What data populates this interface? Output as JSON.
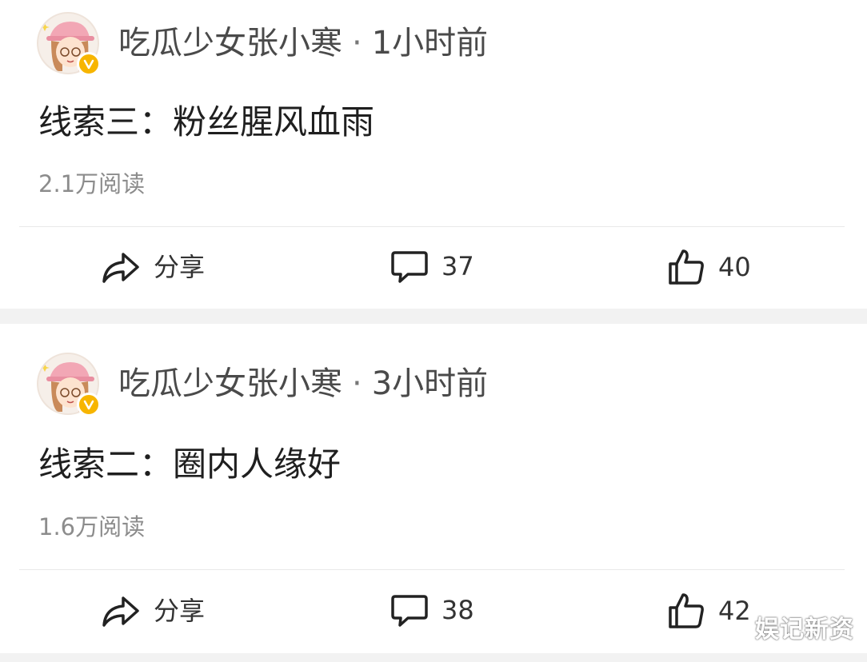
{
  "posts": [
    {
      "author": "吃瓜少女张小寒",
      "separator": "·",
      "time": "1小时前",
      "title": "线索三：粉丝腥风血雨",
      "reads": "2.1万阅读",
      "share_label": "分享",
      "comments": "37",
      "likes": "40",
      "verified_icon": "verified-v-icon"
    },
    {
      "author": "吃瓜少女张小寒",
      "separator": "·",
      "time": "3小时前",
      "title": "线索二：圈内人缘好",
      "reads": "1.6万阅读",
      "share_label": "分享",
      "comments": "38",
      "likes": "42",
      "verified_icon": "verified-v-icon"
    }
  ],
  "watermark": "娱记新资",
  "colors": {
    "background": "#f2f2f2",
    "card": "#ffffff",
    "verified_badge": "#f7b500",
    "secondary_text": "#8c8c8c"
  }
}
